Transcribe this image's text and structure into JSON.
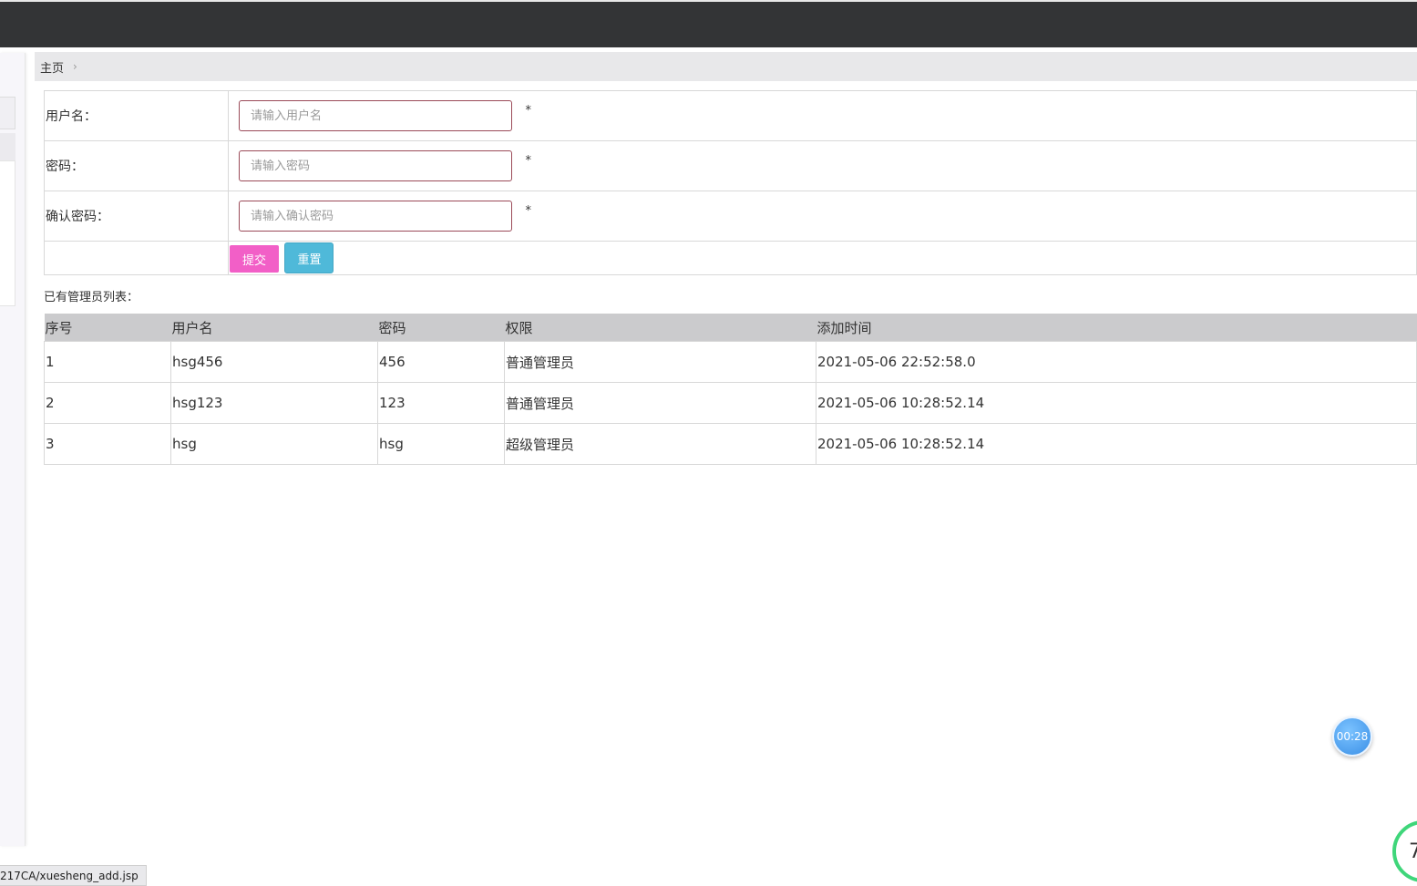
{
  "breadcrumb": {
    "home": "主页",
    "separator": "›"
  },
  "form": {
    "username": {
      "label": "用户名：",
      "placeholder": "请输入用户名",
      "required": "*"
    },
    "password": {
      "label": "密码：",
      "placeholder": "请输入密码",
      "required": "*"
    },
    "confirm": {
      "label": "确认密码：",
      "placeholder": "请输入确认密码",
      "required": "*"
    },
    "submit_label": "提交",
    "reset_label": "重置"
  },
  "list": {
    "title": "已有管理员列表：",
    "columns": [
      "序号",
      "用户名",
      "密码",
      "权限",
      "添加时间"
    ],
    "rows": [
      [
        "1",
        "hsg456",
        "456",
        "普通管理员",
        "2021-05-06 22:52:58.0"
      ],
      [
        "2",
        "hsg123",
        "123",
        "普通管理员",
        "2021-05-06 10:28:52.14"
      ],
      [
        "3",
        "hsg",
        "hsg",
        "超级管理员",
        "2021-05-06 10:28:52.14"
      ]
    ]
  },
  "overlay": {
    "timer": "00:28",
    "corner_digit": "7"
  },
  "status_url": "217CA/xuesheng_add.jsp",
  "colors": {
    "topbar": "#333436",
    "submit": "#f25fc7",
    "reset": "#4fb9d9",
    "header_row": "#cbcbcd",
    "input_border": "#9b4a58"
  }
}
